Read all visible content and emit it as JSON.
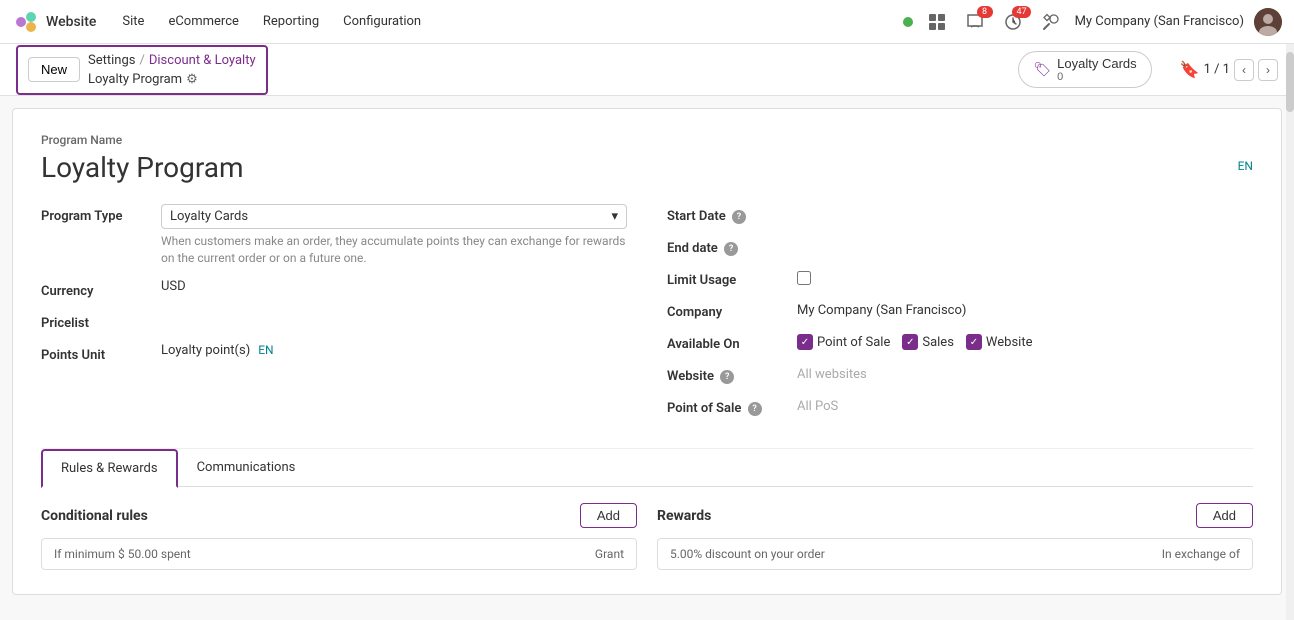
{
  "navbar": {
    "brand": "Website",
    "links": [
      "Website",
      "Site",
      "eCommerce",
      "Reporting",
      "Configuration"
    ],
    "status_color": "#4CAF50",
    "notifications_count": "8",
    "updates_count": "47",
    "company": "My Company (San Francisco)"
  },
  "actionbar": {
    "new_button": "New",
    "breadcrumb_settings": "Settings",
    "breadcrumb_sep": "/",
    "breadcrumb_link": "Discount & Loyalty",
    "breadcrumb_sub": "Loyalty Program",
    "loyalty_cards_label": "Loyalty Cards",
    "loyalty_cards_count": "0",
    "pagination": "1 / 1"
  },
  "form": {
    "program_name_label": "Program Name",
    "program_title": "Loyalty Program",
    "en_label": "EN",
    "program_type_label": "Program Type",
    "program_type_value": "Loyalty Cards",
    "program_type_desc": "When customers make an order, they accumulate points they can exchange for rewards on the current order or on a future one.",
    "currency_label": "Currency",
    "currency_value": "USD",
    "pricelist_label": "Pricelist",
    "pricelist_value": "",
    "points_unit_label": "Points Unit",
    "points_unit_value": "Loyalty point(s)",
    "start_date_label": "Start Date",
    "end_date_label": "End date",
    "limit_usage_label": "Limit Usage",
    "company_label": "Company",
    "company_value": "My Company (San Francisco)",
    "available_on_label": "Available On",
    "available_on_items": [
      "Point of Sale",
      "Sales",
      "Website"
    ],
    "website_label": "Website",
    "website_value": "All websites",
    "point_of_sale_label": "Point of Sale",
    "point_of_sale_value": "All PoS"
  },
  "tabs": {
    "rules_rewards": "Rules & Rewards",
    "communications": "Communications"
  },
  "conditional_rules": {
    "title": "Conditional rules",
    "add_button": "Add",
    "preview_row": "If minimum $ 50.00 spent",
    "preview_col": "Grant"
  },
  "rewards": {
    "title": "Rewards",
    "add_button": "Add",
    "preview_row": "5.00% discount on your order",
    "preview_col": "In exchange of"
  }
}
